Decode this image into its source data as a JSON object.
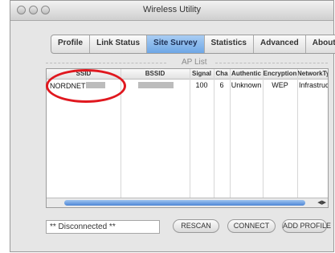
{
  "window": {
    "title": "Wireless Utility"
  },
  "tabs": [
    {
      "label": "Profile"
    },
    {
      "label": "Link Status"
    },
    {
      "label": "Site Survey"
    },
    {
      "label": "Statistics"
    },
    {
      "label": "Advanced"
    },
    {
      "label": "About"
    }
  ],
  "ap_list": {
    "title": "AP List",
    "columns": [
      "SSID",
      "BSSID",
      "Signal",
      "Cha",
      "Authentic",
      "Encryption",
      "NetworkTyp"
    ],
    "rows": [
      {
        "ssid": "NORDNET",
        "bssid": "",
        "signal": "100",
        "channel": "6",
        "auth": "Unknown",
        "encryption": "WEP",
        "network_type": "Infrastruct"
      }
    ]
  },
  "status": {
    "text": "** Disconnected **"
  },
  "buttons": {
    "rescan": "RESCAN",
    "connect": "CONNECT",
    "add_profile": "ADD PROFILE"
  },
  "colors": {
    "accent": "#2231c9",
    "highlight": "#e0181f"
  }
}
